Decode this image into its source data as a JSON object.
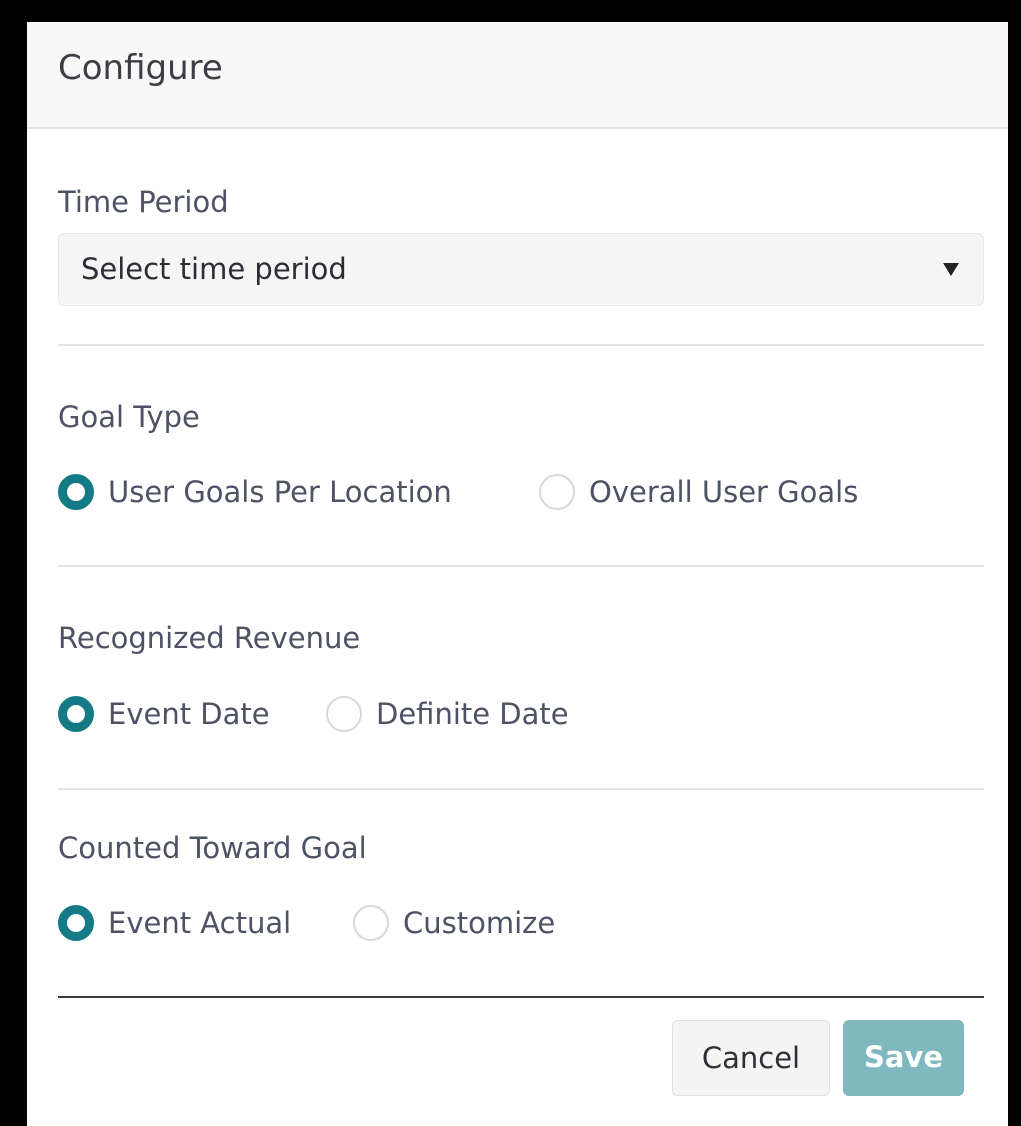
{
  "dialog": {
    "title": "Configure"
  },
  "time_period": {
    "label": "Time Period",
    "select_value": "Select time period"
  },
  "goal_type": {
    "label": "Goal Type",
    "options": [
      {
        "label": "User Goals Per Location",
        "selected": true
      },
      {
        "label": "Overall User Goals",
        "selected": false
      }
    ]
  },
  "recognized_revenue": {
    "label": "Recognized Revenue",
    "options": [
      {
        "label": "Event Date",
        "selected": true
      },
      {
        "label": "Definite Date",
        "selected": false
      }
    ]
  },
  "counted_toward_goal": {
    "label": "Counted Toward Goal",
    "options": [
      {
        "label": "Event Actual",
        "selected": true
      },
      {
        "label": "Customize",
        "selected": false
      }
    ]
  },
  "footer": {
    "cancel_label": "Cancel",
    "save_label": "Save"
  },
  "colors": {
    "accent": "#147a85",
    "save_button": "#7fb8be",
    "header_bg": "#f8f8f8"
  }
}
